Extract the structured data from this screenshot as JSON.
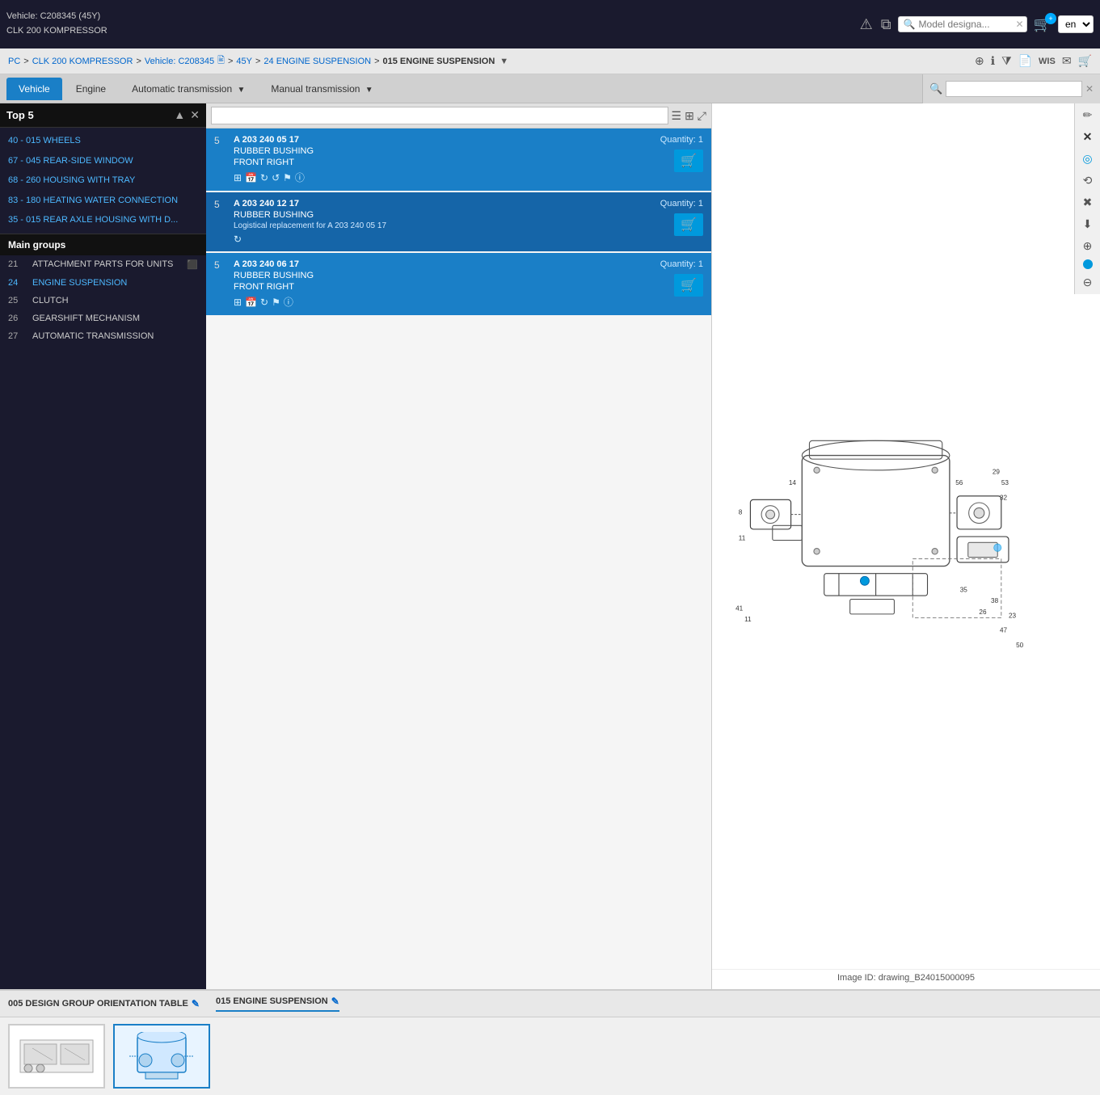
{
  "topbar": {
    "vehicle_line1": "Vehicle: C208345 (45Y)",
    "vehicle_line2": "CLK 200 KOMPRESSOR",
    "lang": "en",
    "search_placeholder": "Model designa..."
  },
  "breadcrumb": {
    "items": [
      {
        "label": "PC",
        "link": true
      },
      {
        "label": "CLK 200 KOMPRESSOR",
        "link": true
      },
      {
        "label": "Vehicle: C208345",
        "link": true
      },
      {
        "label": "45Y",
        "link": true
      },
      {
        "label": "24 ENGINE SUSPENSION",
        "link": true
      },
      {
        "label": "015 ENGINE SUSPENSION",
        "link": false
      }
    ]
  },
  "nav": {
    "tabs": [
      {
        "label": "Vehicle",
        "active": true,
        "has_arrow": false
      },
      {
        "label": "Engine",
        "active": false,
        "has_arrow": false
      },
      {
        "label": "Automatic transmission",
        "active": false,
        "has_arrow": true
      },
      {
        "label": "Manual transmission",
        "active": false,
        "has_arrow": true
      }
    ],
    "search_placeholder": ""
  },
  "left_panel": {
    "top5_title": "Top 5",
    "top5_items": [
      "40 - 015 WHEELS",
      "67 - 045 REAR-SIDE WINDOW",
      "68 - 260 HOUSING WITH TRAY",
      "83 - 180 HEATING WATER CONNECTION",
      "35 - 015 REAR AXLE HOUSING WITH D..."
    ],
    "main_groups_title": "Main groups",
    "groups": [
      {
        "num": "21",
        "label": "ATTACHMENT PARTS FOR UNITS",
        "active": false
      },
      {
        "num": "24",
        "label": "ENGINE SUSPENSION",
        "active": true
      },
      {
        "num": "25",
        "label": "CLUTCH",
        "active": false
      },
      {
        "num": "26",
        "label": "GEARSHIFT MECHANISM",
        "active": false
      },
      {
        "num": "27",
        "label": "AUTOMATIC TRANSMISSION",
        "active": false
      }
    ]
  },
  "parts": [
    {
      "num": "5",
      "code": "A 203 240 05 17",
      "name": "RUBBER BUSHING",
      "sub": "FRONT RIGHT",
      "note": "",
      "qty_label": "Quantity:",
      "qty": "1"
    },
    {
      "num": "5",
      "code": "A 203 240 12 17",
      "name": "RUBBER BUSHING",
      "sub": "",
      "note": "Logistical replacement for A 203 240 05 17",
      "qty_label": "Quantity:",
      "qty": "1"
    },
    {
      "num": "5",
      "code": "A 203 240 06 17",
      "name": "RUBBER BUSHING",
      "sub": "FRONT RIGHT",
      "note": "",
      "qty_label": "Quantity:",
      "qty": "1"
    }
  ],
  "diagram": {
    "image_id": "Image ID: drawing_B24015000095"
  },
  "bottom": {
    "tabs": [
      {
        "label": "005 DESIGN GROUP ORIENTATION TABLE",
        "edit_icon": true
      },
      {
        "label": "015 ENGINE SUSPENSION",
        "edit_icon": true
      }
    ]
  }
}
